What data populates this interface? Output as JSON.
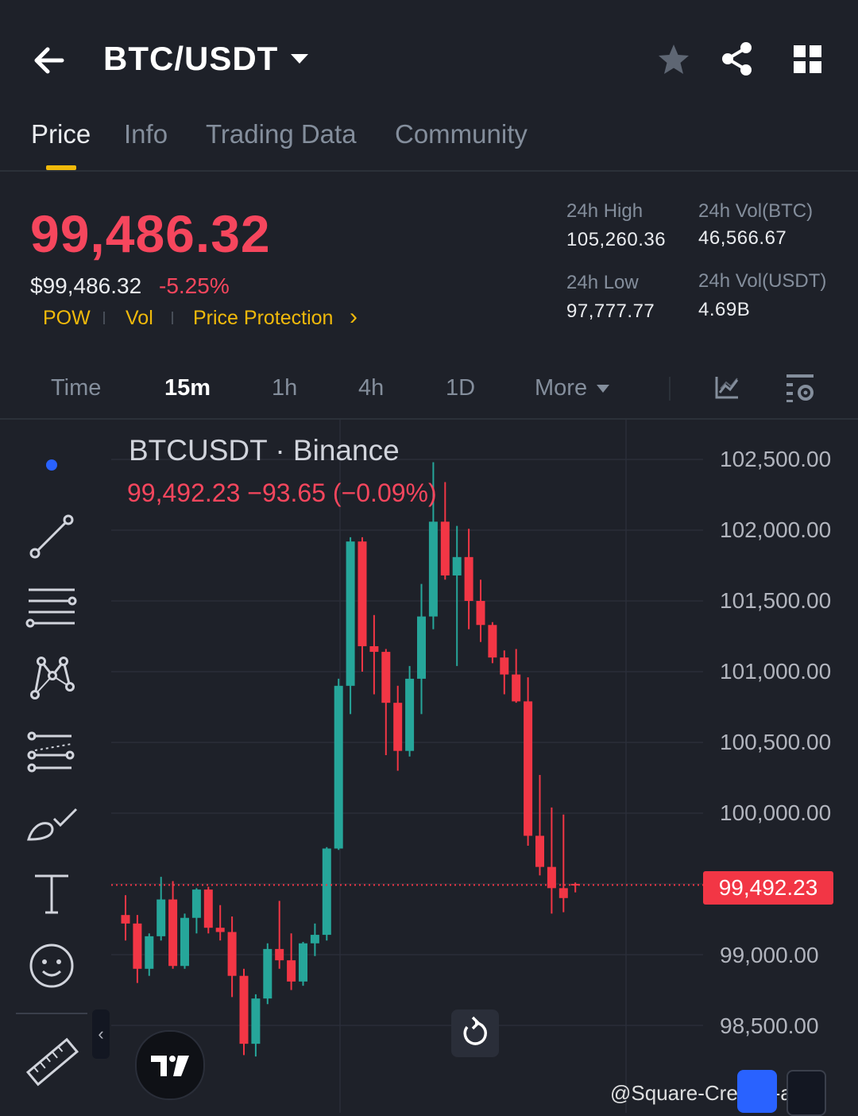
{
  "header": {
    "pair": "BTC/USDT",
    "back_icon": "arrow-left-icon",
    "star_icon": "star-icon",
    "share_icon": "share-icon",
    "grid_icon": "grid-icon"
  },
  "tabs": [
    {
      "label": "Price",
      "active": true
    },
    {
      "label": "Info"
    },
    {
      "label": "Trading Data"
    },
    {
      "label": "Community"
    }
  ],
  "price": {
    "last": "99,486.32",
    "fiat": "$99,486.32",
    "change_pct": "-5.25%",
    "tags": [
      "POW",
      "Vol",
      "Price Protection"
    ],
    "chevron": "›"
  },
  "stats": {
    "high_label": "24h High",
    "high_value": "105,260.36",
    "low_label": "24h Low",
    "low_value": "97,777.77",
    "vol_btc_label": "24h Vol(BTC)",
    "vol_btc_value": "46,566.67",
    "vol_usdt_label": "24h Vol(USDT)",
    "vol_usdt_value": "4.69B"
  },
  "intervals": [
    {
      "label": "Time"
    },
    {
      "label": "15m",
      "active": true
    },
    {
      "label": "1h"
    },
    {
      "label": "4h"
    },
    {
      "label": "1D"
    },
    {
      "label": "More"
    }
  ],
  "chart": {
    "title": "BTCUSDT · Binance",
    "ohlc_line": "99,492.23  −93.65 (−0.09%)",
    "current_price_label": "99,492.23",
    "y_ticks": [
      "102,500.00",
      "102,000.00",
      "101,500.00",
      "101,000.00",
      "100,500.00",
      "100,000.00",
      "99,000.00",
      "98,500.00"
    ]
  },
  "chart_data": {
    "type": "candlestick",
    "title": "BTCUSDT · Binance",
    "ylim": [
      98200,
      102800
    ],
    "current_price": 99492.23,
    "up_color": "#26a69a",
    "down_color": "#f23645",
    "candles": [
      {
        "o": 99280,
        "h": 99420,
        "l": 99100,
        "c": 99220
      },
      {
        "o": 99220,
        "h": 99280,
        "l": 98800,
        "c": 98900
      },
      {
        "o": 98900,
        "h": 99150,
        "l": 98850,
        "c": 99130
      },
      {
        "o": 99130,
        "h": 99550,
        "l": 99100,
        "c": 99390
      },
      {
        "o": 99390,
        "h": 99520,
        "l": 98900,
        "c": 98920
      },
      {
        "o": 98920,
        "h": 99290,
        "l": 98900,
        "c": 99260
      },
      {
        "o": 99260,
        "h": 99470,
        "l": 99150,
        "c": 99460
      },
      {
        "o": 99460,
        "h": 99480,
        "l": 99150,
        "c": 99190
      },
      {
        "o": 99190,
        "h": 99350,
        "l": 99100,
        "c": 99160
      },
      {
        "o": 99160,
        "h": 99270,
        "l": 98700,
        "c": 98850
      },
      {
        "o": 98850,
        "h": 98900,
        "l": 98290,
        "c": 98370
      },
      {
        "o": 98370,
        "h": 98720,
        "l": 98280,
        "c": 98690
      },
      {
        "o": 98690,
        "h": 99080,
        "l": 98650,
        "c": 99040
      },
      {
        "o": 99040,
        "h": 99380,
        "l": 98900,
        "c": 98960
      },
      {
        "o": 98960,
        "h": 99150,
        "l": 98750,
        "c": 98810
      },
      {
        "o": 98810,
        "h": 99090,
        "l": 98780,
        "c": 99080
      },
      {
        "o": 99080,
        "h": 99220,
        "l": 98990,
        "c": 99140
      },
      {
        "o": 99140,
        "h": 99760,
        "l": 99100,
        "c": 99750
      },
      {
        "o": 99750,
        "h": 100950,
        "l": 99740,
        "c": 100900
      },
      {
        "o": 100900,
        "h": 101950,
        "l": 100700,
        "c": 101920
      },
      {
        "o": 101920,
        "h": 101950,
        "l": 101000,
        "c": 101180
      },
      {
        "o": 101180,
        "h": 101400,
        "l": 100840,
        "c": 101140
      },
      {
        "o": 101140,
        "h": 101160,
        "l": 100410,
        "c": 100780
      },
      {
        "o": 100780,
        "h": 100900,
        "l": 100300,
        "c": 100440
      },
      {
        "o": 100440,
        "h": 101040,
        "l": 100400,
        "c": 100950
      },
      {
        "o": 100950,
        "h": 101620,
        "l": 100700,
        "c": 101390
      },
      {
        "o": 101390,
        "h": 102480,
        "l": 101300,
        "c": 102060
      },
      {
        "o": 102060,
        "h": 102340,
        "l": 101650,
        "c": 101680
      },
      {
        "o": 101680,
        "h": 102030,
        "l": 101040,
        "c": 101810
      },
      {
        "o": 101810,
        "h": 102010,
        "l": 101300,
        "c": 101500
      },
      {
        "o": 101500,
        "h": 101650,
        "l": 101210,
        "c": 101330
      },
      {
        "o": 101330,
        "h": 101350,
        "l": 101060,
        "c": 101100
      },
      {
        "o": 101100,
        "h": 101150,
        "l": 100840,
        "c": 100980
      },
      {
        "o": 100980,
        "h": 101160,
        "l": 100780,
        "c": 100790
      },
      {
        "o": 100790,
        "h": 100960,
        "l": 99770,
        "c": 99840
      },
      {
        "o": 99840,
        "h": 100270,
        "l": 99560,
        "c": 99620
      },
      {
        "o": 99620,
        "h": 100040,
        "l": 99290,
        "c": 99470
      },
      {
        "o": 99470,
        "h": 99990,
        "l": 99300,
        "c": 99400
      },
      {
        "o": 99500,
        "h": 99510,
        "l": 99440,
        "c": 99492.23
      }
    ]
  },
  "toolbar": {
    "icons": [
      "cursor-dot-icon",
      "trend-line-icon",
      "horizontal-lines-icon",
      "pattern-icon",
      "projection-icon",
      "brush-icon",
      "text-icon",
      "emoji-icon",
      "ruler-icon"
    ]
  },
  "watermark": "@Square-Creator-a5f0"
}
